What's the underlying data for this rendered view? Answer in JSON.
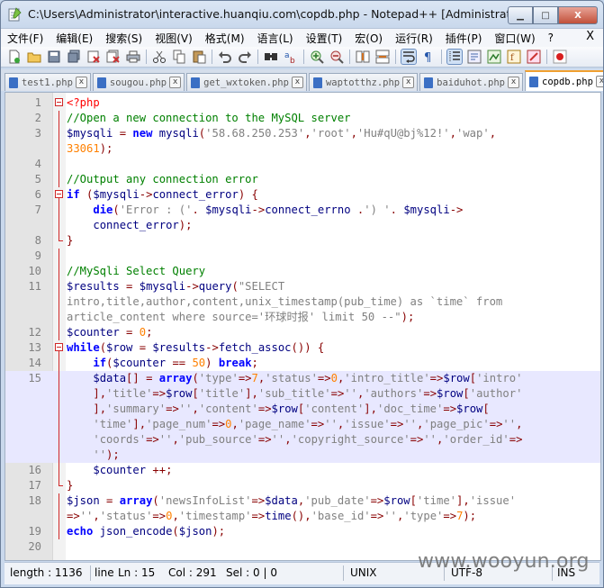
{
  "window": {
    "title": "C:\\Users\\Administrator\\interactive.huanqiu.com\\copdb.php - Notepad++ [Administrator]",
    "minimize_glyph": "▁",
    "maximize_glyph": "□",
    "close_glyph": "X"
  },
  "menu": {
    "items": [
      "文件(F)",
      "编辑(E)",
      "搜索(S)",
      "视图(V)",
      "格式(M)",
      "语言(L)",
      "设置(T)",
      "宏(O)",
      "运行(R)",
      "插件(P)",
      "窗口(W)",
      "?"
    ],
    "close_glyph": "X"
  },
  "tabs": [
    {
      "label": "test1.php",
      "active": false
    },
    {
      "label": "sougou.php",
      "active": false
    },
    {
      "label": "get_wxtoken.php",
      "active": false
    },
    {
      "label": "waptotthz.php",
      "active": false
    },
    {
      "label": "baiduhot.php",
      "active": false
    },
    {
      "label": "copdb.php",
      "active": true
    }
  ],
  "tab_close_glyph": "x",
  "colors": {
    "comment": "#008000",
    "keyword": "#0000ff",
    "string": "#808080",
    "number": "#ff8000",
    "current_line": "#e8e8ff"
  },
  "code_lines": [
    {
      "n": "1",
      "t": "<?php"
    },
    {
      "n": "2",
      "t": "//Open a new connection to the MySQL server"
    },
    {
      "n": "3",
      "t": "$mysqli = new mysqli('58.68.250.253','root','Hu#qU@bj%12!','wap',"
    },
    {
      "n": "",
      "t": "33061);"
    },
    {
      "n": "4",
      "t": ""
    },
    {
      "n": "5",
      "t": "//Output any connection error"
    },
    {
      "n": "6",
      "t": "if ($mysqli->connect_error) {"
    },
    {
      "n": "7",
      "t": "    die('Error : ('. $mysqli->connect_errno .') '. $mysqli->"
    },
    {
      "n": "",
      "t": "    connect_error);"
    },
    {
      "n": "8",
      "t": "}"
    },
    {
      "n": "9",
      "t": ""
    },
    {
      "n": "10",
      "t": "//MySqli Select Query"
    },
    {
      "n": "11",
      "t": "$results = $mysqli->query(\"SELECT"
    },
    {
      "n": "",
      "t": "intro,title,author,content,unix_timestamp(pub_time) as `time` from"
    },
    {
      "n": "",
      "t": "article_content where source='环球时报' limit 50 --\");"
    },
    {
      "n": "12",
      "t": "$counter = 0;"
    },
    {
      "n": "13",
      "t": "while($row = $results->fetch_assoc()) {"
    },
    {
      "n": "14",
      "t": "    if($counter == 50) break;"
    },
    {
      "n": "15",
      "t": "    $data[] = array('type'=>7,'status'=>0,'intro_title'=>$row['intro'"
    },
    {
      "n": "",
      "t": "    ],'title'=>$row['title'],'sub_title'=>'','authors'=>$row['author'"
    },
    {
      "n": "",
      "t": "    ],'summary'=>'','content'=>$row['content'],'doc_time'=>$row["
    },
    {
      "n": "",
      "t": "    'time'],'page_num'=>0,'page_name'=>'','issue'=>'','page_pic'=>'',"
    },
    {
      "n": "",
      "t": "    'coords'=>'','pub_source'=>'','copyright_source'=>'','order_id'=>"
    },
    {
      "n": "",
      "t": "    '');"
    },
    {
      "n": "16",
      "t": "    $counter ++;"
    },
    {
      "n": "17",
      "t": "}"
    },
    {
      "n": "18",
      "t": "$json = array('newsInfoList'=>$data,'pub_date'=>$row['time'],'issue'"
    },
    {
      "n": "",
      "t": "=>'','status'=>0,'timestamp'=>time(),'base_id'=>'','type'=>7);"
    },
    {
      "n": "19",
      "t": "echo json_encode($json);"
    },
    {
      "n": "20",
      "t": ""
    }
  ],
  "status": {
    "length": "length : 1136",
    "line": "line",
    "ln": "Ln : 15",
    "col": "Col : 291",
    "sel": "Sel : 0 | 0",
    "eol": "UNIX",
    "encoding": "UTF-8",
    "mode": "INS"
  },
  "watermark": "www.wooyun.org"
}
